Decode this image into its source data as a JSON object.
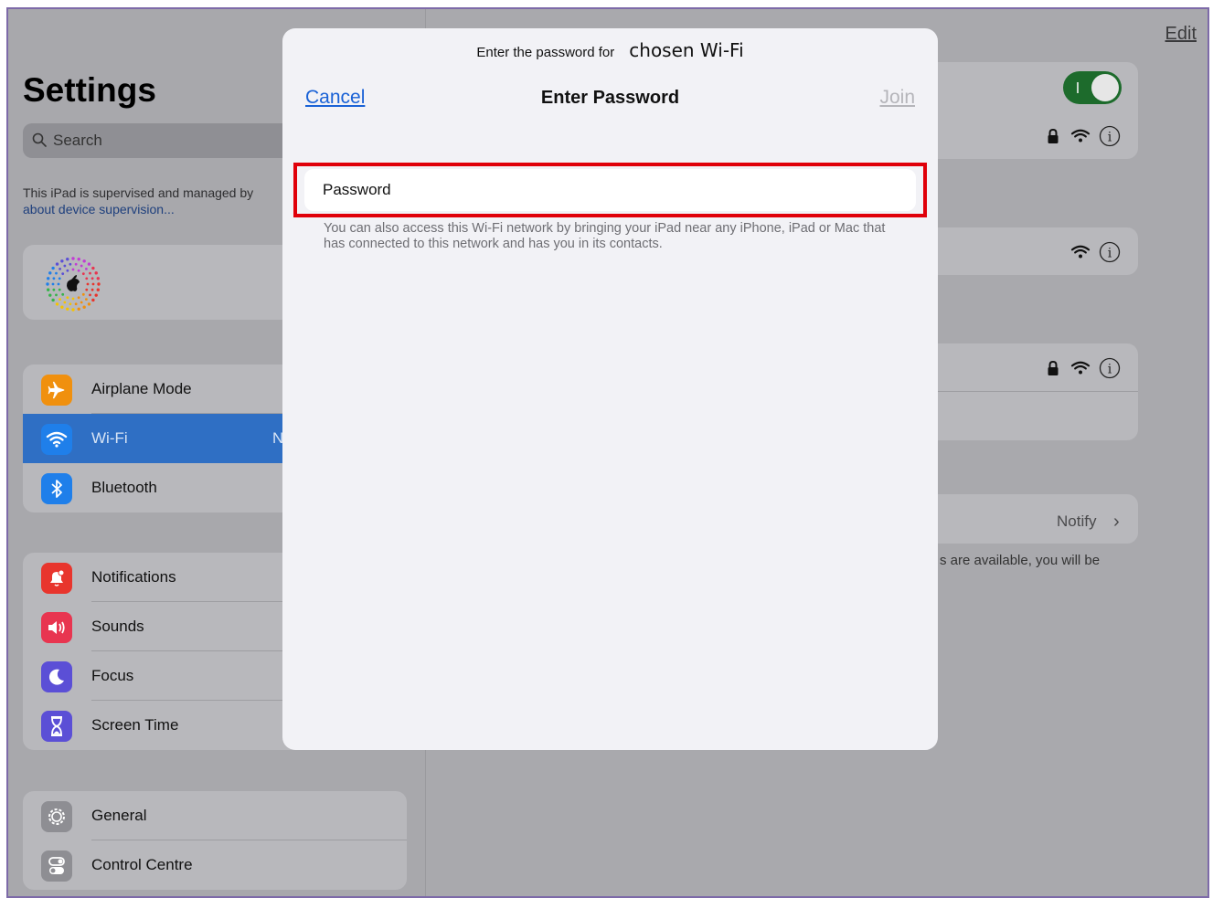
{
  "sidebar": {
    "title": "Settings",
    "search_placeholder": "Search",
    "supervision_text": "This iPad is supervised and managed by",
    "supervision_link": "about device supervision...",
    "groups": [
      {
        "items": [
          {
            "label": "Airplane Mode",
            "icon": "airplane-icon",
            "color": "#f0900e"
          },
          {
            "label": "Wi-Fi",
            "icon": "wifi-icon",
            "color": "#1f7fea",
            "value": "N",
            "active": true
          },
          {
            "label": "Bluetooth",
            "icon": "bluetooth-icon",
            "color": "#1f7fea"
          }
        ]
      },
      {
        "items": [
          {
            "label": "Notifications",
            "icon": "bell-icon",
            "color": "#e8352d"
          },
          {
            "label": "Sounds",
            "icon": "speaker-icon",
            "color": "#e83550"
          },
          {
            "label": "Focus",
            "icon": "moon-icon",
            "color": "#5b4fd6"
          },
          {
            "label": "Screen Time",
            "icon": "hourglass-icon",
            "color": "#5b4fd6"
          }
        ]
      },
      {
        "items": [
          {
            "label": "General",
            "icon": "gear-icon",
            "color": "#8e8e93"
          },
          {
            "label": "Control Centre",
            "icon": "switches-icon",
            "color": "#8e8e93"
          }
        ]
      }
    ]
  },
  "detail": {
    "edit_label": "Edit",
    "notify_label": "Notify",
    "available_text": "s are available, you will be"
  },
  "modal": {
    "prompt_prefix": "Enter the password for",
    "network_name": "chosen Wi-Fi",
    "cancel_label": "Cancel",
    "title": "Enter Password",
    "join_label": "Join",
    "password_placeholder": "Password",
    "password_value": "",
    "hint": "You can also access this Wi-Fi network by bringing your iPad near any iPhone, iPad or Mac that has connected to this network and has you in its contacts."
  },
  "colors": {
    "accent": "#1a62d6",
    "highlight": "#e0000a",
    "toggle_on": "#1d6b2c"
  }
}
